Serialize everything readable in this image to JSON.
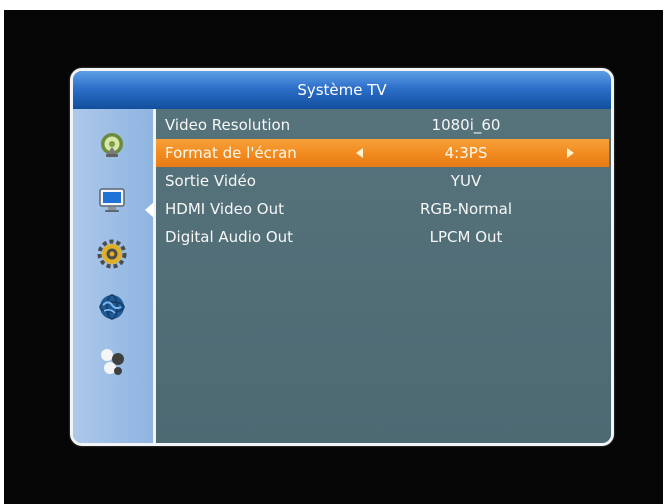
{
  "window": {
    "title": "Système TV"
  },
  "sidebar": {
    "icons": [
      "satellite-dish-icon",
      "monitor-icon",
      "settings-gear-icon",
      "globe-icon",
      "network-icon"
    ]
  },
  "menu": {
    "items": [
      {
        "label": "Video Resolution",
        "value": "1080i_60"
      },
      {
        "label": "Format de l'écran",
        "value": "4:3PS"
      },
      {
        "label": "Sortie Vidéo",
        "value": "YUV"
      },
      {
        "label": "HDMI Video Out",
        "value": "RGB-Normal"
      },
      {
        "label": "Digital Audio Out",
        "value": "LPCM Out"
      }
    ],
    "selected_index": 1
  },
  "colors": {
    "titlebar": "#2d6fc9",
    "selected_row": "#f18a1f",
    "panel": "#4f6b74",
    "sidebar": "#9bbde5"
  }
}
